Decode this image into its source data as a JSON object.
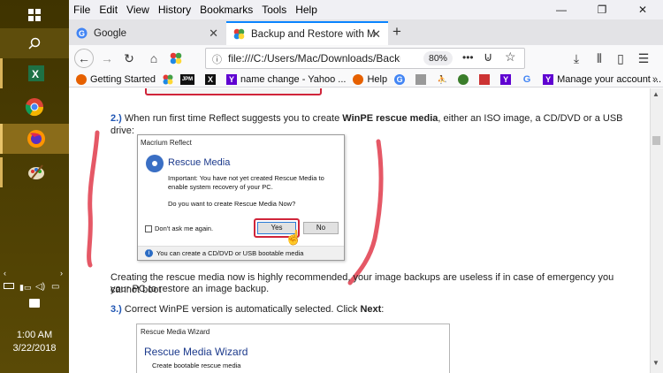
{
  "taskbar": {
    "clock_time": "1:00 AM",
    "clock_date": "3/22/2018"
  },
  "menubar": {
    "items": [
      "File",
      "Edit",
      "View",
      "History",
      "Bookmarks",
      "Tools",
      "Help"
    ]
  },
  "tabs": [
    {
      "label": "Google",
      "selected": false
    },
    {
      "label": "Backup and Restore with Macr",
      "selected": true
    }
  ],
  "navbar": {
    "url": "file:///C:/Users/Mac/Downloads/Backu",
    "zoom": "80%",
    "more": "•••"
  },
  "bookmarks": [
    {
      "label": "Getting Started",
      "icon": "firefox-icon",
      "color": "#e66000"
    },
    {
      "label": "",
      "icon": "pinwheel-icon",
      "color": "#c33"
    },
    {
      "label": "",
      "icon": "jpm-icon",
      "color": "#111"
    },
    {
      "label": "",
      "icon": "x-icon",
      "color": "#111"
    },
    {
      "label": "name change - Yahoo ...",
      "icon": "yahoo-icon",
      "color": "#5f01d1"
    },
    {
      "label": "Help",
      "icon": "firefox-icon",
      "color": "#e66000"
    },
    {
      "label": "",
      "icon": "google-icon",
      "color": "#4285f4"
    },
    {
      "label": "",
      "icon": "image-icon",
      "color": "#888"
    },
    {
      "label": "",
      "icon": "figure-icon",
      "color": "#111"
    },
    {
      "label": "",
      "icon": "leaf-icon",
      "color": "#3a7d2a"
    },
    {
      "label": "",
      "icon": "puzzle-icon",
      "color": "#c33"
    },
    {
      "label": "",
      "icon": "yahoo-icon",
      "color": "#5f01d1"
    },
    {
      "label": "",
      "icon": "google-icon",
      "color": "#4285f4"
    },
    {
      "label": "Manage your account ...",
      "icon": "yahoo-icon",
      "color": "#5f01d1"
    }
  ],
  "content": {
    "step2_num": "2.)",
    "step2_text_a": " When run first time Reflect suggests you to create ",
    "step2_bold": "WinPE rescue media",
    "step2_text_b": ", either an ISO image, a CD/DVD or a USB drive:",
    "para_line1": "Creating the rescue media now is highly recommended, your image backups are useless if in case of emergency you cannot boot",
    "para_line2": "your PC to restore an image backup.",
    "step3_num": "3.)",
    "step3_text": " Correct WinPE version is automatically selected. Click ",
    "step3_bold": "Next",
    "step3_end": ":"
  },
  "dialog": {
    "title": "Macrium Reflect",
    "heading": "Rescue Media",
    "line1": "Important: You have not yet created Rescue Media to",
    "line2": "enable system recovery of your PC.",
    "question": "Do you want to create Rescue Media Now?",
    "checkbox_label": "Don't ask me again.",
    "yes_label": "Yes",
    "no_label": "No",
    "footer": "You can create a CD/DVD or USB bootable media"
  },
  "wizard": {
    "title": "Rescue Media Wizard",
    "heading": "Rescue Media Wizard",
    "subtitle": "Create bootable rescue media"
  },
  "colors": {
    "taskbar": "#4b3d00",
    "accent_tab": "#0a84ff",
    "step_blue": "#1f55b3",
    "annotation_red": "#e03b4b"
  }
}
